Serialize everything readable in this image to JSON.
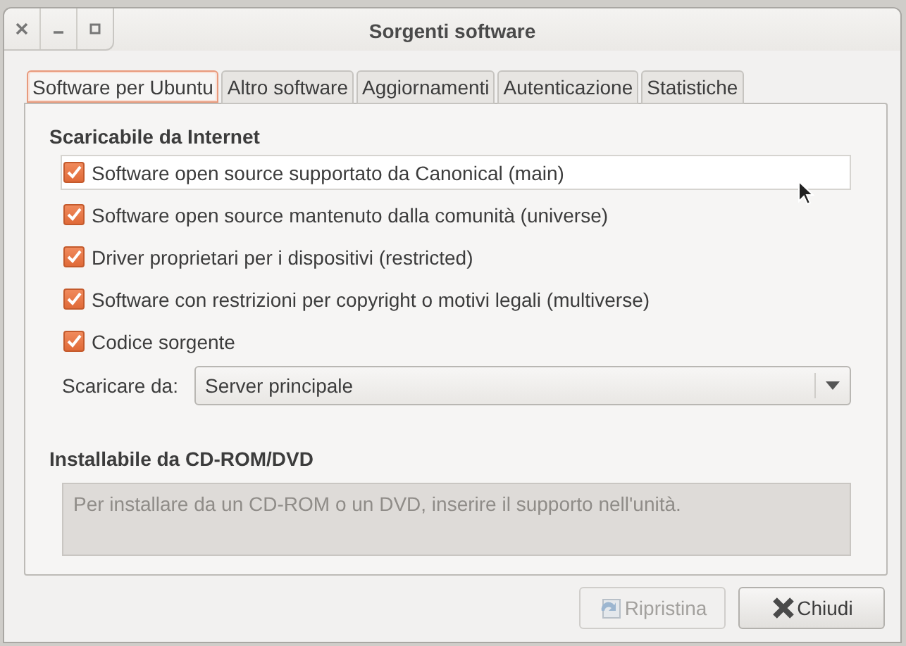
{
  "window": {
    "title": "Sorgenti software"
  },
  "tabs": [
    {
      "label": "Software per Ubuntu",
      "selected": true
    },
    {
      "label": "Altro software",
      "selected": false
    },
    {
      "label": "Aggiornamenti",
      "selected": false
    },
    {
      "label": "Autenticazione",
      "selected": false
    },
    {
      "label": "Statistiche",
      "selected": false
    }
  ],
  "internet_section": {
    "heading": "Scaricabile da Internet",
    "sources": [
      {
        "label": "Software open source supportato da Canonical (main)",
        "checked": true,
        "highlighted": true
      },
      {
        "label": "Software open source mantenuto dalla comunità (universe)",
        "checked": true,
        "highlighted": false
      },
      {
        "label": "Driver proprietari per i dispositivi (restricted)",
        "checked": true,
        "highlighted": false
      },
      {
        "label": "Software con restrizioni per copyright o motivi legali (multiverse)",
        "checked": true,
        "highlighted": false
      },
      {
        "label": "Codice sorgente",
        "checked": true,
        "highlighted": false
      }
    ],
    "download_from": {
      "label": "Scaricare da:",
      "value": "Server principale"
    }
  },
  "cdrom_section": {
    "heading": "Installabile da CD-ROM/DVD",
    "notice": "Per installare da un CD-ROM o un DVD, inserire il supporto nell'unità.",
    "disabled": true
  },
  "buttons": [
    {
      "kind": "revert",
      "label": "Ripristina",
      "disabled": true
    },
    {
      "kind": "close",
      "label": "Chiudi",
      "disabled": false
    }
  ]
}
